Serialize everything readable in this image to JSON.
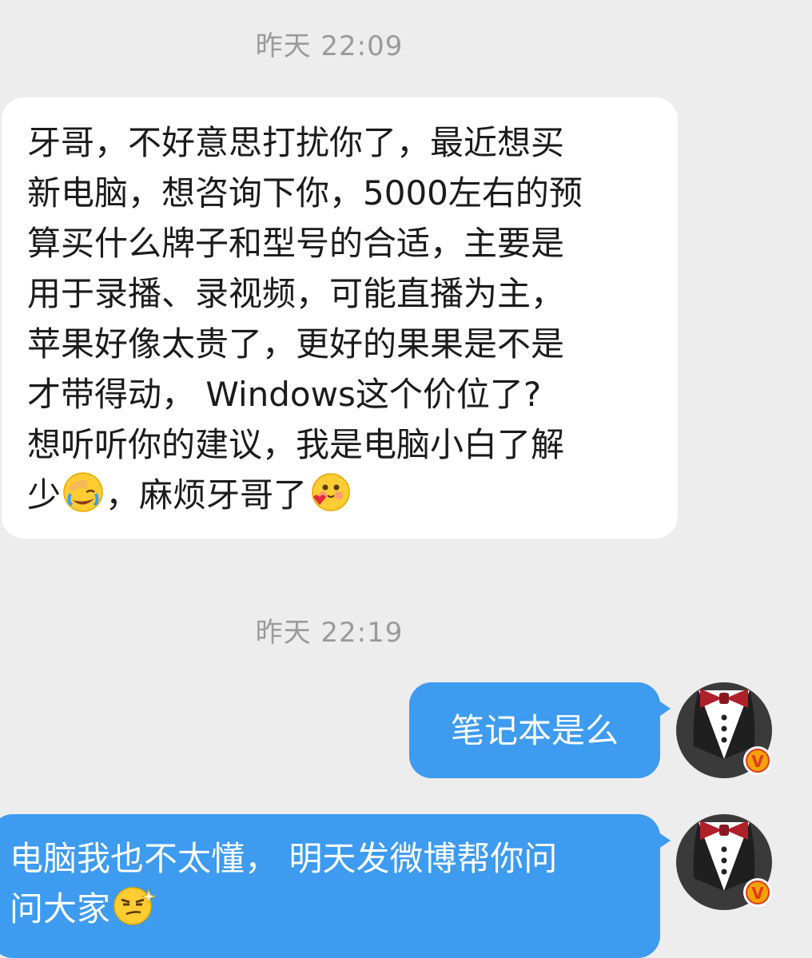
{
  "timestamps": [
    "昨天 22:09",
    "昨天 22:19"
  ],
  "incoming_message": {
    "lines": [
      "牙哥，不好意思打扰你了，最近想买",
      "新电脑，想咨询下你，5000左右的预",
      "算买什么牌子和型号的合适，主要是",
      "用于录播、录视频，可能直播为主，",
      "苹果好像太贵了，更好的果果是不是",
      "才带得动， Windows这个价位了?",
      "想听听你的建议，我是电脑小白了解"
    ],
    "last_line_a": "少",
    "last_line_b": "，麻烦牙哥了",
    "emojis": [
      "facepalm-laugh-emoji",
      "shy-blush-emoji"
    ]
  },
  "outgoing_messages": [
    {
      "text": "笔记本是么"
    },
    {
      "line1": "电脑我也不太懂， 明天发微博帮你问",
      "line2": "问大家",
      "emoji": "smirk-sparkle-emoji"
    }
  ],
  "avatar": {
    "badge": "V",
    "badge_color": "#f5a300",
    "bowtie_color": "#b0202a"
  },
  "colors": {
    "background": "#ededed",
    "incoming_bubble": "#ffffff",
    "outgoing_bubble": "#3d9bf0",
    "timestamp": "#9a9a9a"
  }
}
